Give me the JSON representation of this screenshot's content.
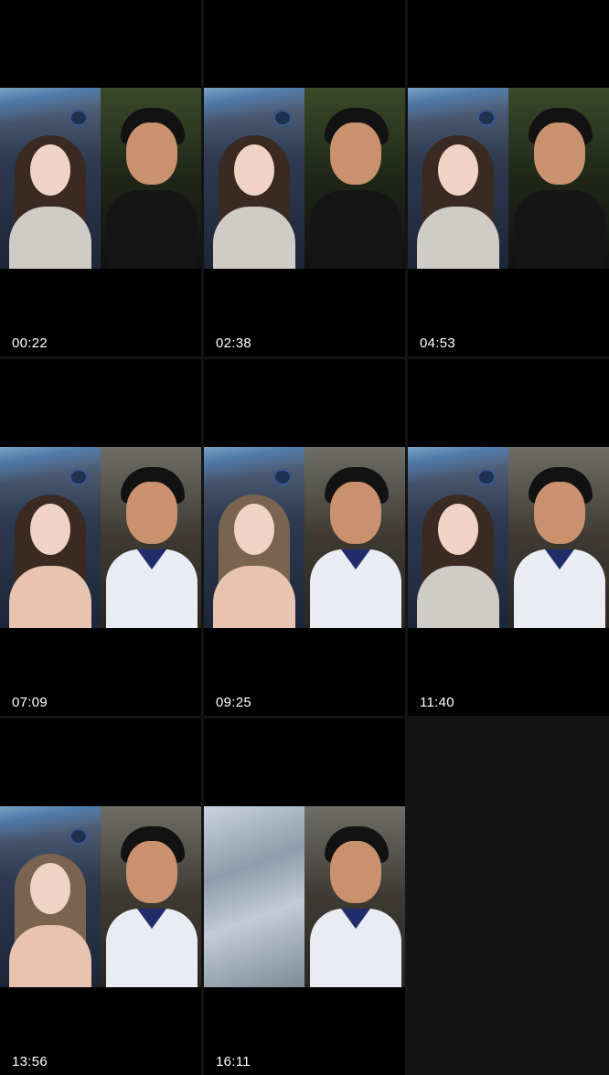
{
  "videos": [
    {
      "duration": "00:22"
    },
    {
      "duration": "02:38"
    },
    {
      "duration": "04:53"
    },
    {
      "duration": "07:09"
    },
    {
      "duration": "09:25"
    },
    {
      "duration": "11:40"
    },
    {
      "duration": "13:56"
    },
    {
      "duration": "16:11"
    }
  ]
}
